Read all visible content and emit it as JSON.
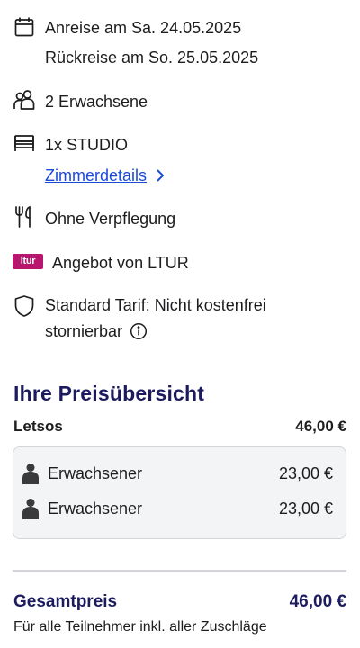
{
  "booking": {
    "arrival": "Anreise am Sa. 24.05.2025",
    "departure": "Rückreise am So. 25.05.2025",
    "travellers": "2 Erwachsene",
    "room": "1x STUDIO",
    "room_details_link": "Zimmerdetails",
    "board": "Ohne Verpflegung",
    "offer_badge": "ltur",
    "offer": "Angebot von LTUR",
    "tariff_line1": "Standard Tarif: Nicht kostenfrei",
    "tariff_line2": "stornierbar"
  },
  "price": {
    "title": "Ihre Preisübersicht",
    "hotel_name": "Letsos",
    "hotel_price": "46,00 €",
    "rows": [
      {
        "label": "Erwachsener",
        "amount": "23,00 €"
      },
      {
        "label": "Erwachsener",
        "amount": "23,00 €"
      }
    ],
    "total_label": "Gesamtpreis",
    "total_amount": "46,00 €",
    "total_note": "Für alle Teilnehmer inkl. aller Zuschläge"
  },
  "icons": {
    "calendar": "calendar-icon",
    "persons": "persons-icon",
    "bed": "bed-icon",
    "cutlery": "cutlery-icon",
    "shield": "shield-icon",
    "info": "info-icon",
    "person": "person-icon",
    "chevron": "chevron-right-icon"
  },
  "colors": {
    "heading": "#1c1b5e",
    "link": "#1a4bd8",
    "ltur_badge": "#b8176f",
    "box_bg": "#f3f4f6"
  }
}
